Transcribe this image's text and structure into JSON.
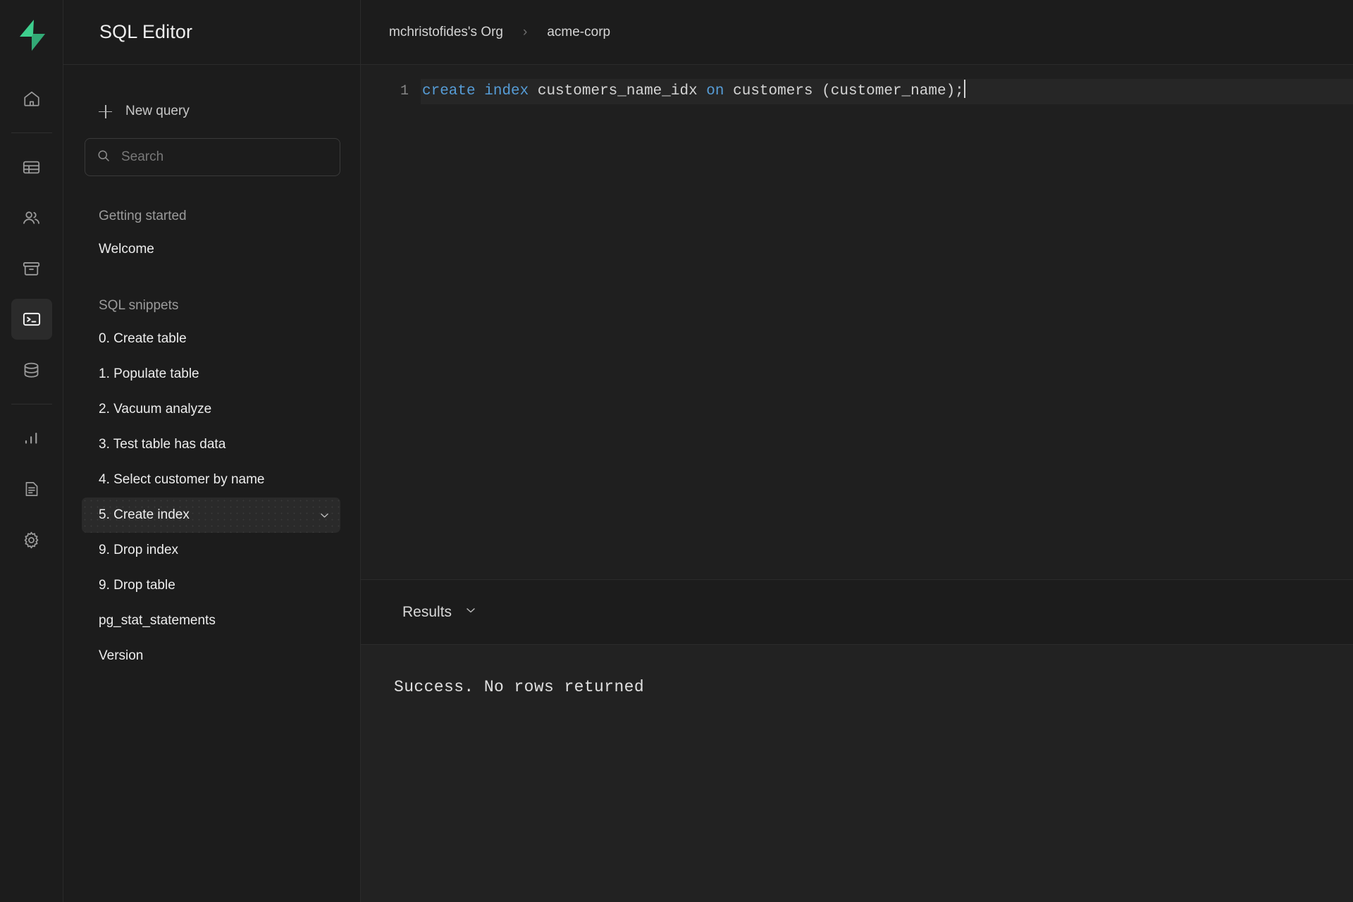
{
  "rail": {
    "logo_name": "supabase-logo",
    "items": [
      {
        "name": "home-icon",
        "label": "Home",
        "active": false
      },
      {
        "name": "table-editor-icon",
        "label": "Table Editor",
        "active": false
      },
      {
        "name": "authentication-icon",
        "label": "Authentication",
        "active": false
      },
      {
        "name": "storage-icon",
        "label": "Storage",
        "active": false
      },
      {
        "name": "sql-editor-icon",
        "label": "SQL Editor",
        "active": true
      },
      {
        "name": "database-icon",
        "label": "Database",
        "active": false
      },
      {
        "name": "reports-icon",
        "label": "Reports",
        "active": false
      },
      {
        "name": "logs-icon",
        "label": "Logs",
        "active": false
      },
      {
        "name": "settings-icon",
        "label": "Settings",
        "active": false
      }
    ]
  },
  "sidebar": {
    "title": "SQL Editor",
    "new_query_label": "New query",
    "search": {
      "placeholder": "Search",
      "value": ""
    },
    "sections": [
      {
        "label": "Getting started",
        "items": [
          {
            "label": "Welcome",
            "selected": false
          }
        ]
      },
      {
        "label": "SQL snippets",
        "items": [
          {
            "label": "0. Create table",
            "selected": false
          },
          {
            "label": "1. Populate table",
            "selected": false
          },
          {
            "label": "2. Vacuum analyze",
            "selected": false
          },
          {
            "label": "3. Test table has data",
            "selected": false
          },
          {
            "label": "4. Select customer by name",
            "selected": false
          },
          {
            "label": "5. Create index",
            "selected": true
          },
          {
            "label": "9. Drop index",
            "selected": false
          },
          {
            "label": "9. Drop table",
            "selected": false
          },
          {
            "label": "pg_stat_statements",
            "selected": false
          },
          {
            "label": "Version",
            "selected": false
          }
        ]
      }
    ]
  },
  "breadcrumb": {
    "org": "mchristofides's Org",
    "separator": "›",
    "project": "acme-corp"
  },
  "editor": {
    "line_number": "1",
    "tokens": [
      {
        "text": "create",
        "type": "keyword"
      },
      {
        "text": " ",
        "type": "plain"
      },
      {
        "text": "index",
        "type": "keyword"
      },
      {
        "text": " customers_name_idx ",
        "type": "plain"
      },
      {
        "text": "on",
        "type": "keyword"
      },
      {
        "text": " customers (customer_name);",
        "type": "plain"
      }
    ],
    "full_text": "create index customers_name_idx on customers (customer_name);"
  },
  "results": {
    "label": "Results",
    "chevron": "chevron-down-icon",
    "message": "Success. No rows returned"
  },
  "colors": {
    "brand_green": "#3ecf8e",
    "keyword_blue": "#569cd6",
    "background": "#1c1c1c",
    "editor_background": "#1f1f1f",
    "results_background": "#222222"
  }
}
